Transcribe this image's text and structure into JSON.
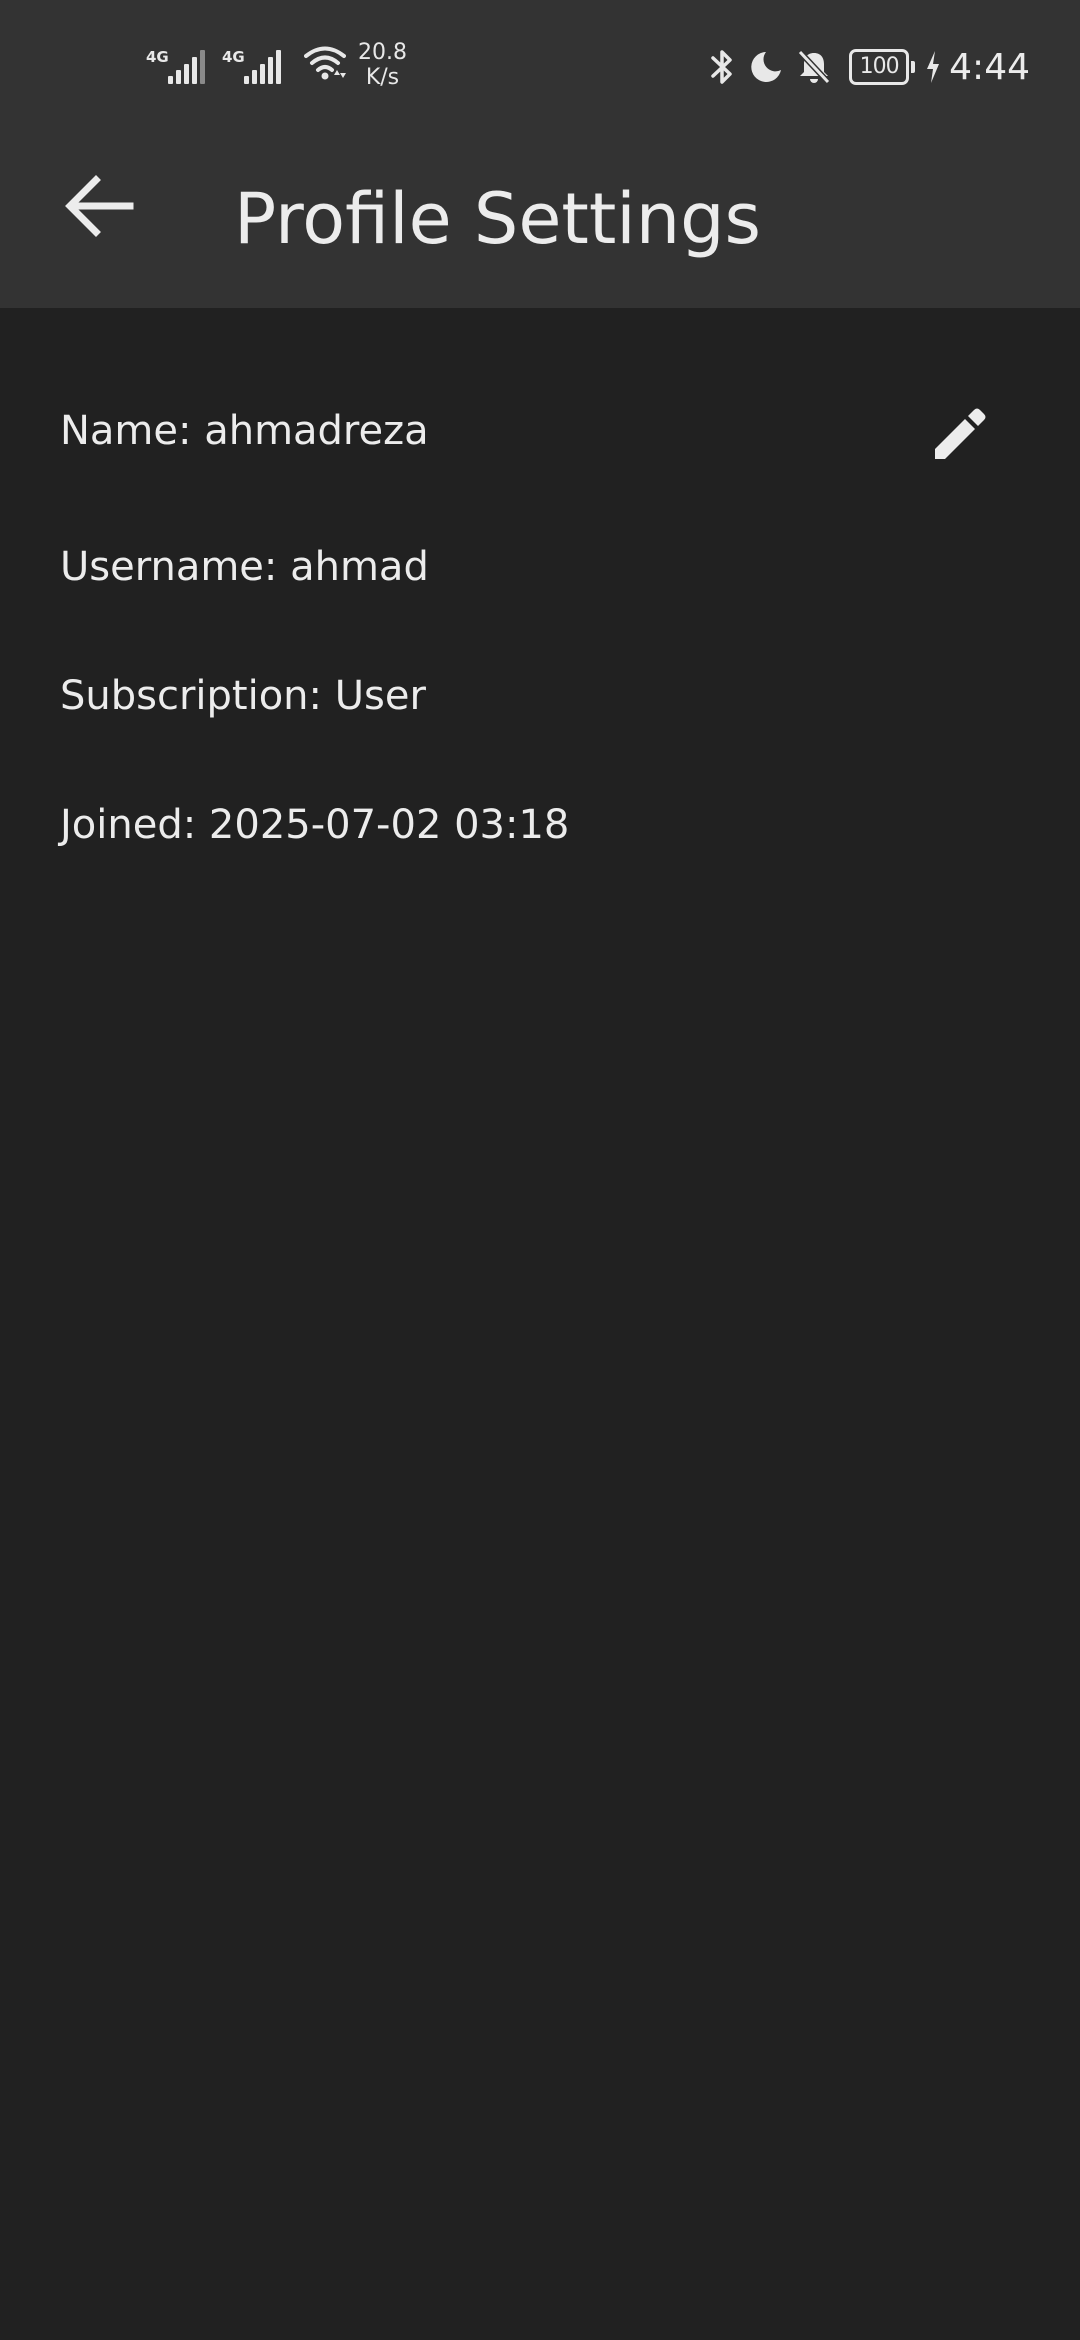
{
  "status_bar": {
    "sim1_label": "4G",
    "sim2_label": "4G",
    "net_speed_value": "20.8",
    "net_speed_unit": "K/s",
    "battery_level": "100",
    "time": "4:44",
    "icons": [
      "signal-icon",
      "signal-icon",
      "wifi-icon",
      "bluetooth-icon",
      "moon-icon",
      "bell-off-icon",
      "battery-icon",
      "charging-icon"
    ]
  },
  "app_bar": {
    "back_icon": "arrow-left-icon",
    "title": "Profile Settings"
  },
  "profile": {
    "name": "Name: ahmadreza",
    "username": "Username: ahmad",
    "subscription": "Subscription: User",
    "joined": "Joined: 2025-07-02 03:18",
    "edit_icon": "pencil-icon"
  },
  "colors": {
    "background": "#212121",
    "bar_background": "#333333",
    "text": "#ececec"
  }
}
